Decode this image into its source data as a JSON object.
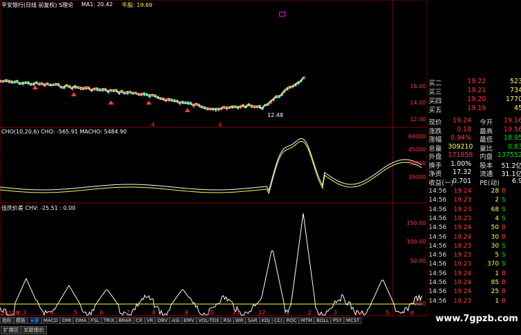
{
  "main_chart": {
    "title": "平安银行(日线 前复权) S理论",
    "ma_label": "MA1: 20.42",
    "ma2_label": "牛股: 19.69",
    "y_labels": [
      "16.00",
      "14.00",
      "12.00"
    ],
    "low_marker": "12.48",
    "mark_a": "4",
    "mark_b": "6"
  },
  "cho_pane": {
    "label": "CHO(10,20,6) CHO: -565.91 MACHO: 5484.90",
    "y_labels": [
      "60000",
      "45000",
      "30000",
      "15000"
    ]
  },
  "chv_pane": {
    "label": "佳庆价差 CHV: -25.51 : 0.00",
    "y_labels": [
      "150.00",
      "100.00",
      "50.00",
      "0.00"
    ]
  },
  "x_axis": {
    "labels": [
      "2012年",
      "3",
      "4",
      "5",
      "6",
      "7",
      "8",
      "9",
      "10",
      "11",
      "12",
      "1",
      "2",
      "3",
      "4",
      "5",
      "6"
    ]
  },
  "tabs": {
    "items": [
      "指标",
      "模板",
      "全部",
      "MACD",
      "DMI",
      "DMA",
      "FSL",
      "TRIX",
      "BRAR",
      "CR",
      "VR",
      "OBV",
      "ASI",
      "EMV",
      "VOL-TDX",
      "RSI",
      "WR",
      "SAR",
      "KDJ",
      "CCI",
      "ROC",
      "MTM",
      "BOLL",
      "PSY",
      "MCST"
    ],
    "active_index": 2
  },
  "bottom_tabs": [
    "扩展区",
    "关联报价"
  ],
  "watermark": "www.7gpzb.com",
  "quote": {
    "bids": [
      {
        "label": "买二",
        "price": "19.22",
        "vol": "523"
      },
      {
        "label": "买三",
        "price": "19.21",
        "vol": "734"
      },
      {
        "label": "买四",
        "price": "19.20",
        "vol": "1770"
      },
      {
        "label": "买五",
        "price": "19.19",
        "vol": "45"
      }
    ],
    "stats": [
      {
        "l1": "现价",
        "v1": "19.24",
        "l2": "今开",
        "v2": "19.16",
        "c1": "red",
        "c2": "red"
      },
      {
        "l1": "涨跌",
        "v1": "0.18",
        "l2": "最高",
        "v2": "19.56",
        "c1": "red",
        "c2": "red"
      },
      {
        "l1": "涨幅",
        "v1": "0.94%",
        "l2": "最低",
        "v2": "18.95",
        "c1": "red",
        "c2": "green"
      },
      {
        "l1": "总量",
        "v1": "309210",
        "l2": "量比",
        "v2": "0.83",
        "c1": "yellow",
        "c2": "green"
      },
      {
        "l1": "外盘",
        "v1": "171658",
        "l2": "内盘",
        "v2": "137552",
        "c1": "red",
        "c2": "green"
      },
      {
        "l1": "换手",
        "v1": "1.00%",
        "l2": "股本",
        "v2": "51.2亿",
        "c1": "white",
        "c2": "white"
      },
      {
        "l1": "净资",
        "v1": "17.32",
        "l2": "流通",
        "v2": "31.1亿",
        "c1": "white",
        "c2": "white"
      },
      {
        "l1": "收益(一)",
        "v1": "0.701",
        "l2": "PE(动)",
        "v2": "6.9",
        "c1": "white",
        "c2": "white"
      }
    ],
    "ticks": [
      {
        "time": "14:56",
        "price": "19.24",
        "vol": "28",
        "side": "B"
      },
      {
        "time": "14:56",
        "price": "19.23",
        "vol": "2",
        "side": "S"
      },
      {
        "time": "14:56",
        "price": "19.23",
        "vol": "68",
        "side": "S"
      },
      {
        "time": "14:56",
        "price": "19.23",
        "vol": "4",
        "side": "S"
      },
      {
        "time": "14:56",
        "price": "19.24",
        "vol": "50",
        "side": "B"
      },
      {
        "time": "14:56",
        "price": "19.24",
        "vol": "30",
        "side": "B"
      },
      {
        "time": "14:56",
        "price": "19.23",
        "vol": "30",
        "side": "S"
      },
      {
        "time": "14:56",
        "price": "19.23",
        "vol": "5",
        "side": "S"
      },
      {
        "time": "14:56",
        "price": "19.23",
        "vol": "370",
        "side": "S"
      },
      {
        "time": "14:56",
        "price": "19.24",
        "vol": "1",
        "side": "B"
      },
      {
        "time": "14:56",
        "price": "19.24",
        "vol": "85",
        "side": "B"
      },
      {
        "time": "14:56",
        "price": "19.24",
        "vol": "25",
        "side": "B"
      },
      {
        "time": "14:56",
        "price": "19.23",
        "vol": "1",
        "side": "B"
      }
    ]
  }
}
